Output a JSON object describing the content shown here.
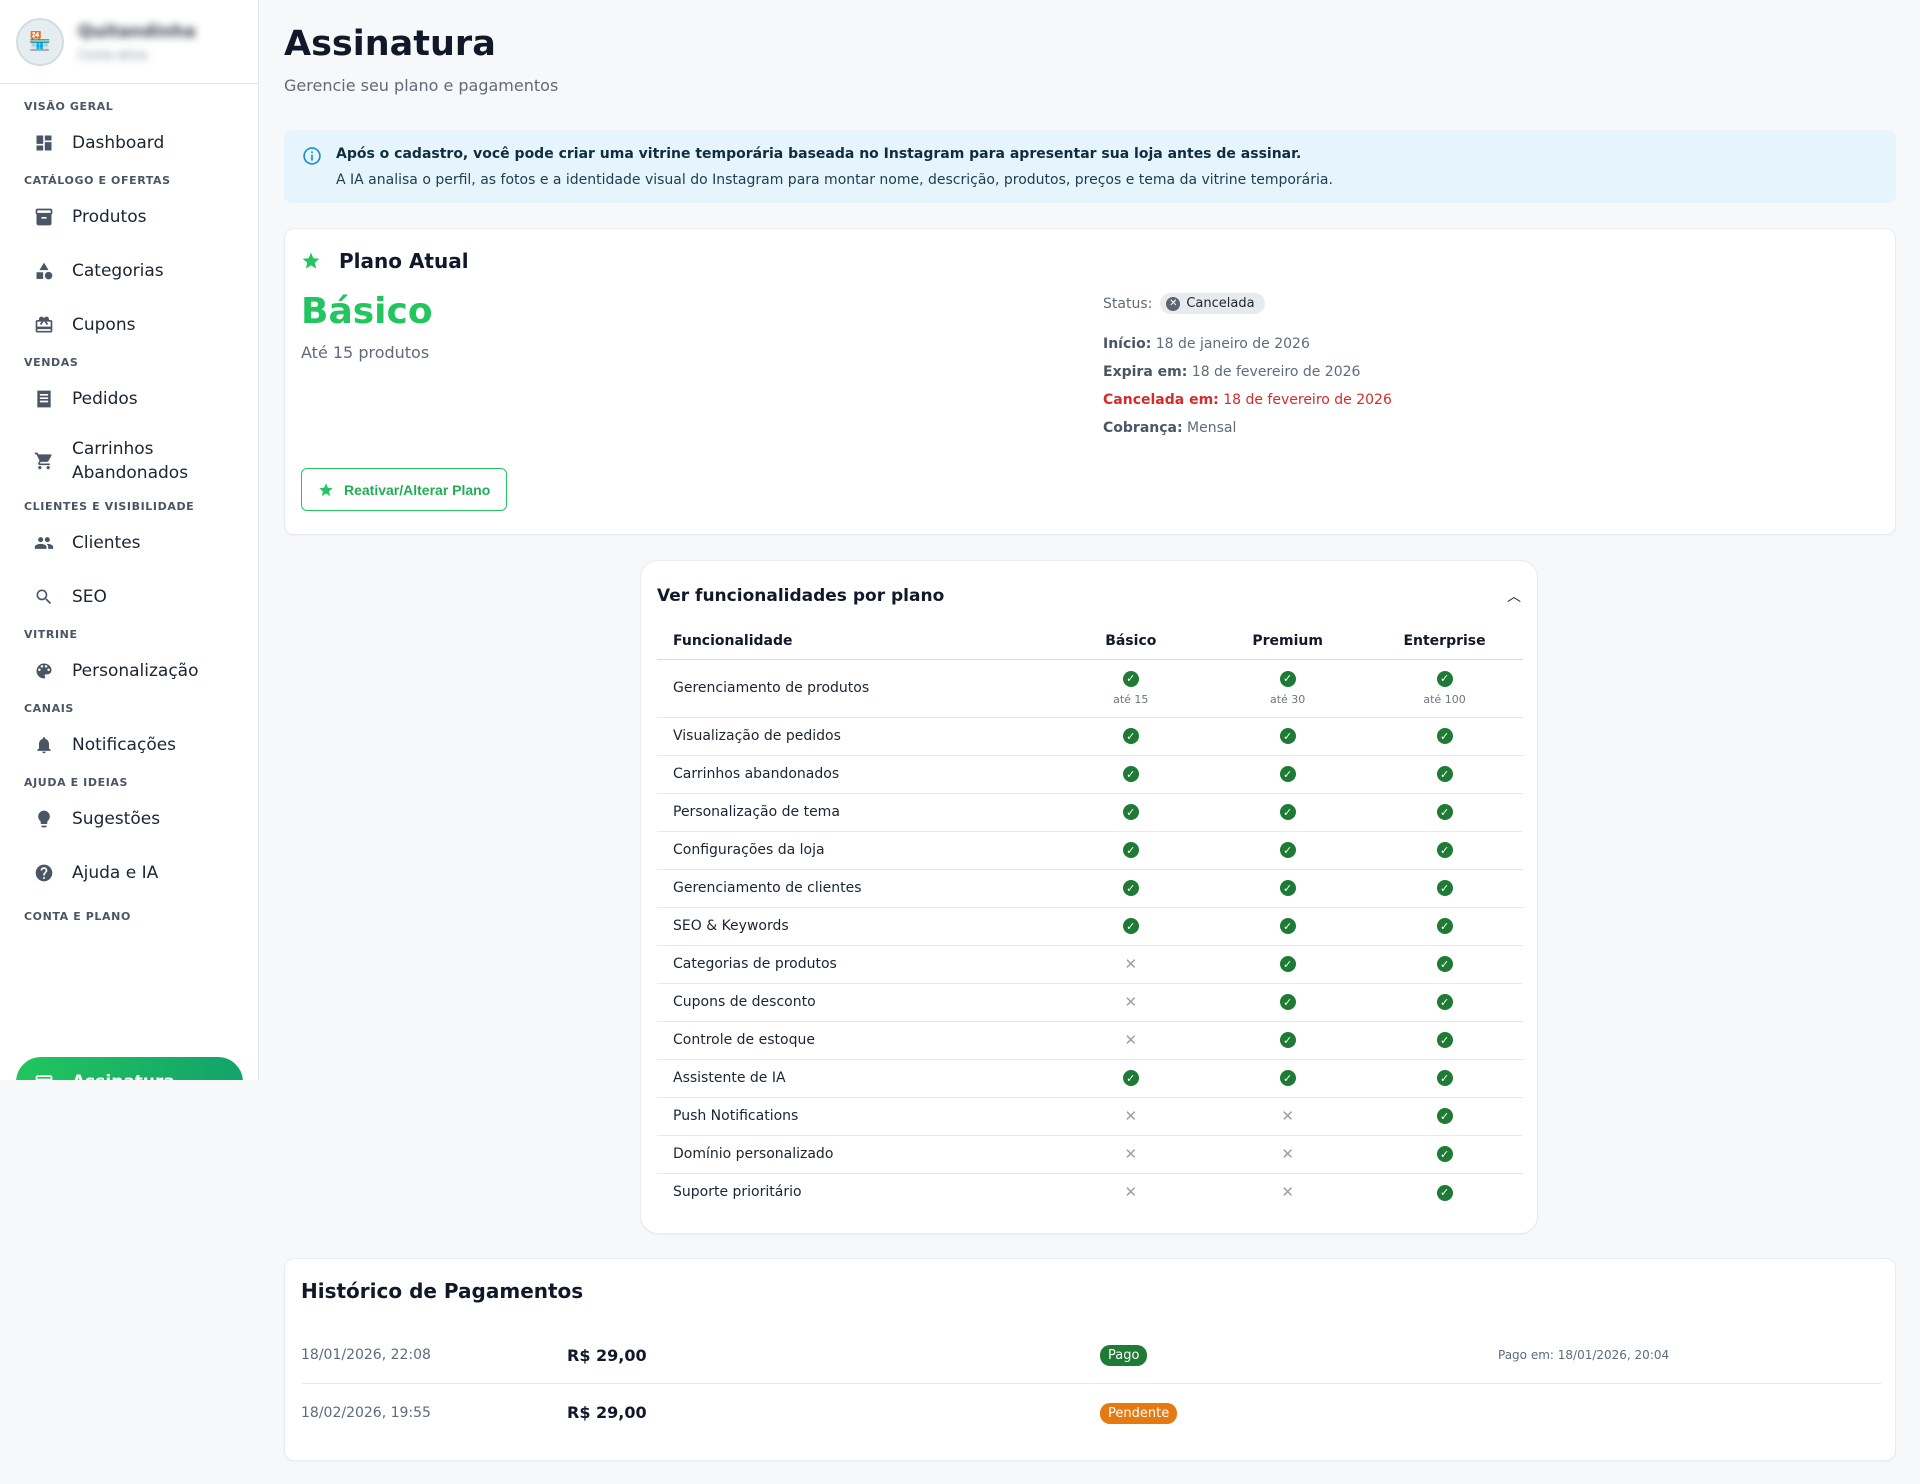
{
  "sidebar": {
    "profile": {
      "name": "Quitandinha",
      "subtitle": "Conta ativa"
    },
    "sections": [
      {
        "label": "VISÃO GERAL",
        "items": [
          {
            "label": "Dashboard",
            "icon": "dashboard-icon"
          }
        ]
      },
      {
        "label": "CATÁLOGO E OFERTAS",
        "items": [
          {
            "label": "Produtos",
            "icon": "archive-icon"
          },
          {
            "label": "Categorias",
            "icon": "category-icon"
          },
          {
            "label": "Cupons",
            "icon": "gift-card-icon"
          }
        ]
      },
      {
        "label": "VENDAS",
        "items": [
          {
            "label": "Pedidos",
            "icon": "receipt-icon"
          },
          {
            "label": "Carrinhos\nAbandonados",
            "icon": "cart-icon"
          }
        ]
      },
      {
        "label": "CLIENTES E VISIBILIDADE",
        "items": [
          {
            "label": "Clientes",
            "icon": "people-icon"
          },
          {
            "label": "SEO",
            "icon": "search-icon"
          }
        ]
      },
      {
        "label": "VITRINE",
        "items": [
          {
            "label": "Personalização",
            "icon": "palette-icon"
          }
        ]
      },
      {
        "label": "CANAIS",
        "items": [
          {
            "label": "Notificações",
            "icon": "bell-icon"
          }
        ]
      },
      {
        "label": "AJUDA E IDEIAS",
        "items": [
          {
            "label": "Sugestões",
            "icon": "lightbulb-icon"
          },
          {
            "label": "Ajuda e IA",
            "icon": "help-icon"
          }
        ]
      },
      {
        "label": "CONTA E PLANO",
        "items": []
      }
    ],
    "active_item": {
      "label": "Assinatura",
      "icon": "credit-card-icon"
    }
  },
  "page": {
    "title": "Assinatura",
    "subtitle": "Gerencie seu plano e pagamentos"
  },
  "info": {
    "title": "Após o cadastro, você pode criar uma vitrine temporária baseada no Instagram para apresentar sua loja antes de assinar.",
    "description": "A IA analisa o perfil, as fotos e a identidade visual do Instagram para montar nome, descrição, produtos, preços e tema da vitrine temporária."
  },
  "plan": {
    "header": "Plano Atual",
    "name": "Básico",
    "limit": "Até 15 produtos",
    "status_label": "Status:",
    "status_value": "Cancelada",
    "start_label": "Início:",
    "start_value": "18 de janeiro de 2026",
    "expires_label": "Expira em:",
    "expires_value": "18 de fevereiro de 2026",
    "cancelled_label": "Cancelada em:",
    "cancelled_value": "18 de fevereiro de 2026",
    "billing_label": "Cobrança:",
    "billing_value": "Mensal",
    "button": "Reativar/Alterar Plano",
    "accent": "#22c55e"
  },
  "features": {
    "title": "Ver funcionalidades por plano",
    "columns": [
      "Funcionalidade",
      "Básico",
      "Premium",
      "Enterprise"
    ],
    "rows": [
      {
        "name": "Gerenciamento de produtos",
        "basic": true,
        "premium": true,
        "enterprise": true,
        "notes": [
          "até 15",
          "até 30",
          "até 100"
        ]
      },
      {
        "name": "Visualização de pedidos",
        "basic": true,
        "premium": true,
        "enterprise": true
      },
      {
        "name": "Carrinhos abandonados",
        "basic": true,
        "premium": true,
        "enterprise": true
      },
      {
        "name": "Personalização de tema",
        "basic": true,
        "premium": true,
        "enterprise": true
      },
      {
        "name": "Configurações da loja",
        "basic": true,
        "premium": true,
        "enterprise": true
      },
      {
        "name": "Gerenciamento de clientes",
        "basic": true,
        "premium": true,
        "enterprise": true
      },
      {
        "name": "SEO & Keywords",
        "basic": true,
        "premium": true,
        "enterprise": true
      },
      {
        "name": "Categorias de produtos",
        "basic": false,
        "premium": true,
        "enterprise": true
      },
      {
        "name": "Cupons de desconto",
        "basic": false,
        "premium": true,
        "enterprise": true
      },
      {
        "name": "Controle de estoque",
        "basic": false,
        "premium": true,
        "enterprise": true
      },
      {
        "name": "Assistente de IA",
        "basic": true,
        "premium": true,
        "enterprise": true
      },
      {
        "name": "Push Notifications",
        "basic": false,
        "premium": false,
        "enterprise": true
      },
      {
        "name": "Domínio personalizado",
        "basic": false,
        "premium": false,
        "enterprise": true
      },
      {
        "name": "Suporte prioritário",
        "basic": false,
        "premium": false,
        "enterprise": true
      }
    ]
  },
  "history": {
    "title": "Histórico de Pagamentos",
    "payments": [
      {
        "date": "18/01/2026, 22:08",
        "amount": "R$ 29,00",
        "status": "Pago",
        "status_color": "#1e7a34",
        "note": "Pago em: 18/01/2026, 20:04"
      },
      {
        "date": "18/02/2026, 19:55",
        "amount": "R$ 29,00",
        "status": "Pendente",
        "status_color": "#e6790f",
        "note": ""
      }
    ]
  }
}
